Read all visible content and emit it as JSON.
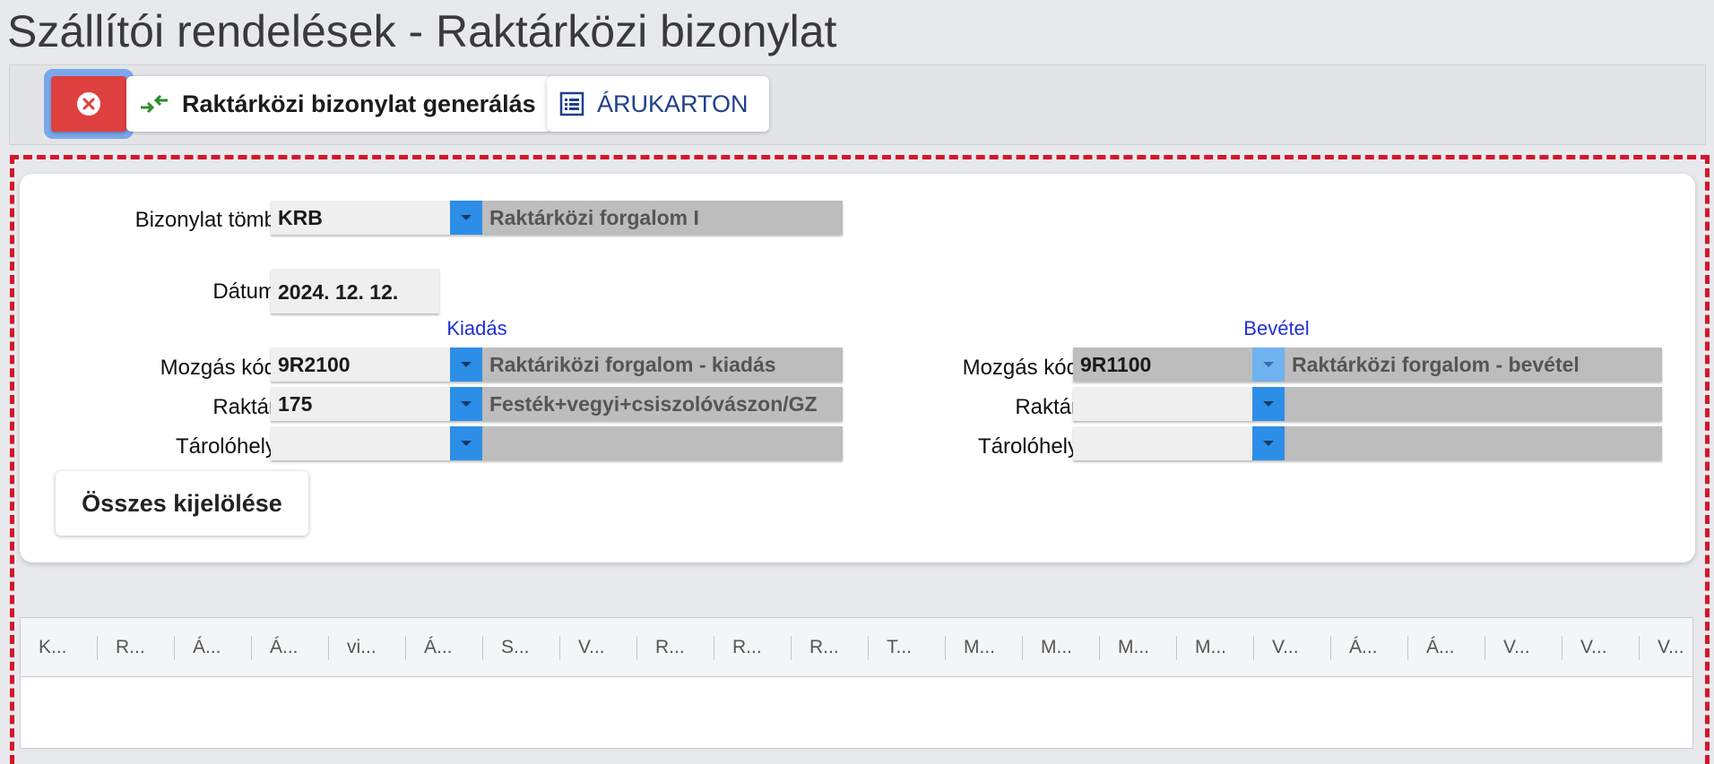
{
  "title": "Szállítói rendelések - Raktárközi bizonylat",
  "toolbar": {
    "generate_label": "Raktárközi bizonylat generálás",
    "article_card_label": "ÁRUKARTON"
  },
  "form": {
    "doc_block": {
      "label": "Bizonylat tömb",
      "code": "KRB",
      "description": "Raktárközi forgalom I"
    },
    "date": {
      "label": "Dátum",
      "value": "2024. 12. 12."
    },
    "issue": {
      "heading": "Kiadás",
      "movement_label": "Mozgás kód",
      "movement_code": "9R2100",
      "movement_desc": "Raktáriközi forgalom - kiadás",
      "warehouse_label": "Raktár",
      "warehouse_code": "175",
      "warehouse_desc": "Festék+vegyi+csiszolóvászon/GZ",
      "location_label": "Tárolóhely",
      "location_code": "",
      "location_desc": ""
    },
    "receipt": {
      "heading": "Bevétel",
      "movement_label": "Mozgás kód",
      "movement_code": "9R1100",
      "movement_desc": "Raktárközi forgalom - bevétel",
      "warehouse_label": "Raktár",
      "warehouse_code": "",
      "warehouse_desc": "",
      "location_label": "Tárolóhely",
      "location_code": "",
      "location_desc": ""
    },
    "select_all_label": "Összes kijelölése"
  },
  "grid": {
    "columns": [
      "K...",
      "R...",
      "Á...",
      "Á...",
      "vi...",
      "Á...",
      "S...",
      "V...",
      "R...",
      "R...",
      "R...",
      "T...",
      "M...",
      "M...",
      "M...",
      "M...",
      "V...",
      "Á...",
      "Á...",
      "V...",
      "V...",
      "V..."
    ]
  },
  "colors": {
    "accent_blue": "#2d8ee8",
    "close_red": "#de4040",
    "frame_red": "#d3172b",
    "heading_blue": "#1f2fd6"
  }
}
